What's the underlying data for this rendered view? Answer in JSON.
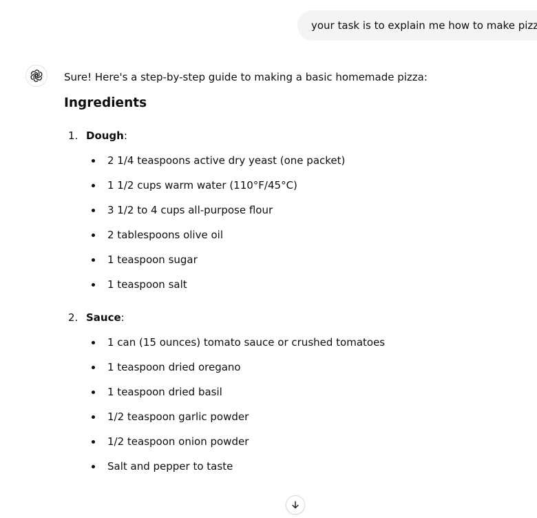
{
  "user_message": "your task is to explain me how to make pizza",
  "assistant": {
    "avatar_icon": "chatgpt-logo-icon",
    "intro": "Sure! Here's a step-by-step guide to making a basic homemade pizza:",
    "heading": "Ingredients",
    "sections": [
      {
        "number": "1.",
        "label": "Dough",
        "suffix": ":",
        "items": [
          "2 1/4 teaspoons active dry yeast (one packet)",
          "1 1/2 cups warm water (110°F/45°C)",
          "3 1/2 to 4 cups all-purpose flour",
          "2 tablespoons olive oil",
          "1 teaspoon sugar",
          "1 teaspoon salt"
        ]
      },
      {
        "number": "2.",
        "label": "Sauce",
        "suffix": ":",
        "items": [
          "1 can (15 ounces) tomato sauce or crushed tomatoes",
          "1 teaspoon dried oregano",
          "1 teaspoon dried basil",
          "1/2 teaspoon garlic powder",
          "1/2 teaspoon onion powder",
          "Salt and pepper to taste"
        ]
      }
    ]
  },
  "scroll_button_icon": "arrow-down-icon"
}
